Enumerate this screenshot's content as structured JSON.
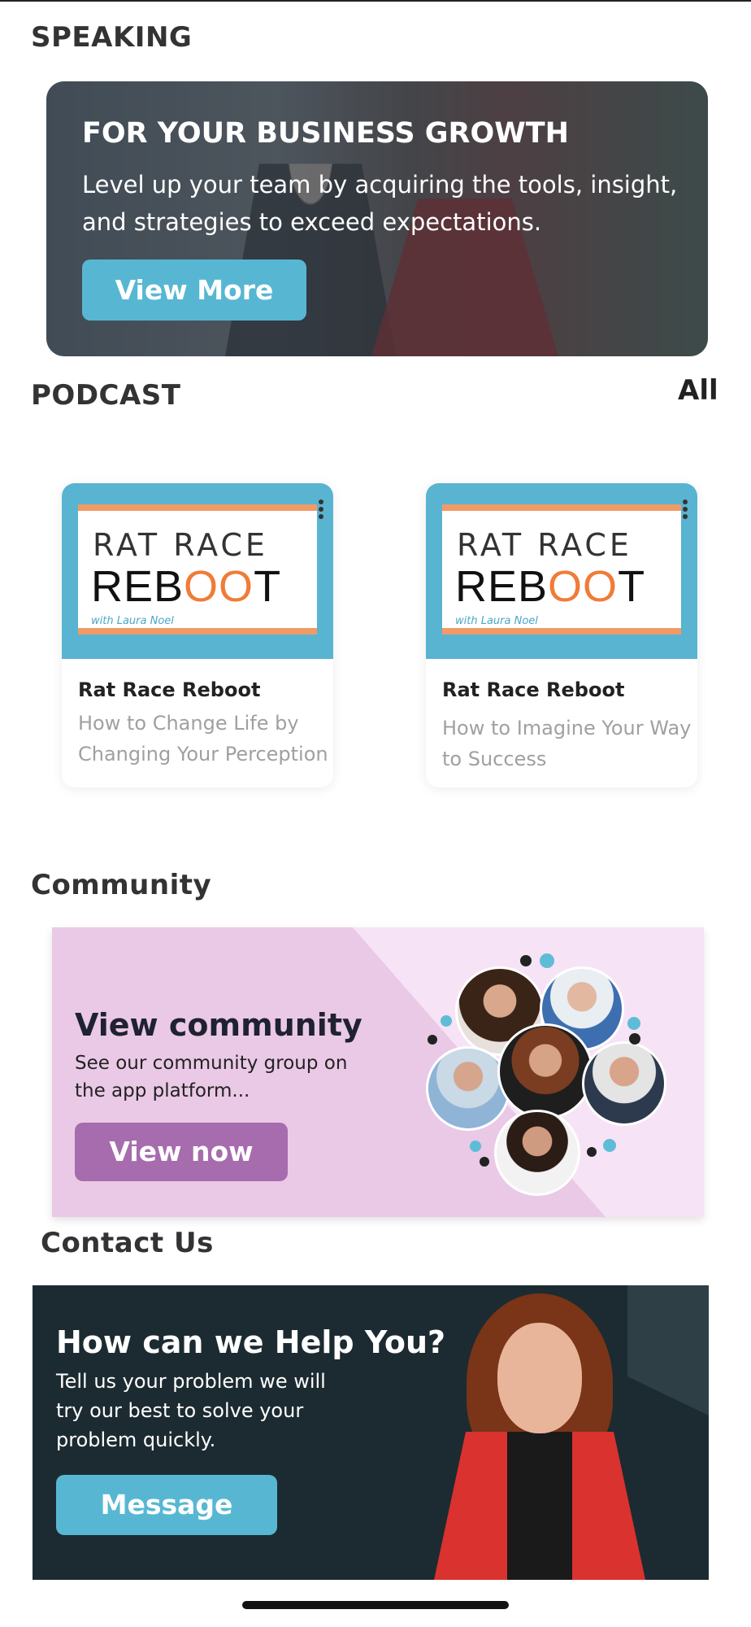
{
  "sections": {
    "speaking": "SPEAKING",
    "podcast": "PODCAST",
    "community": "Community",
    "contact": "Contact Us"
  },
  "speaking_card": {
    "heading": "FOR YOUR BUSINESS GROWTH",
    "text": "Level up your team by acquiring the tools, insight, and strategies to exceed expectations.",
    "button": "View More"
  },
  "podcast": {
    "all_label": "All",
    "cover_line1": "RAT RACE",
    "cover_line2a": "REB",
    "cover_line2b": "OO",
    "cover_line2c": "T",
    "cover_sig": "with Laura Noel",
    "items": [
      {
        "title": "Rat Race Reboot",
        "subtitle": "How to Change Life by Changing Your Perception"
      },
      {
        "title": "Rat Race Reboot",
        "subtitle": "How to Imagine Your Way to Success"
      }
    ]
  },
  "community_card": {
    "heading": "View community",
    "text": "See our community group on the app platform...",
    "button": "View now"
  },
  "contact_card": {
    "heading": "How can we Help You?",
    "text": "Tell us your problem we will try our best to solve your problem quickly.",
    "button": "Message"
  },
  "colors": {
    "accent_blue": "#57b7d3",
    "accent_purple": "#a66cad",
    "accent_orange": "#f19a66"
  }
}
